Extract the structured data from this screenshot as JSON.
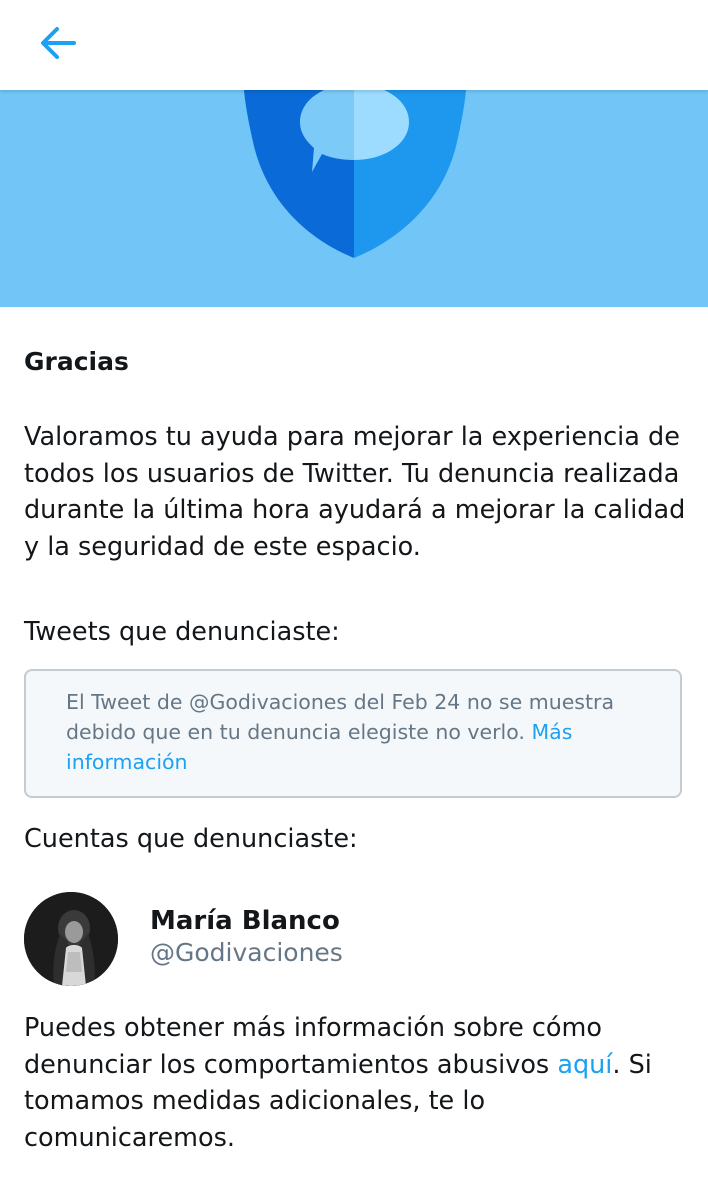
{
  "header": {
    "back_icon": "arrow-left-icon",
    "accent_color": "#1da1f2"
  },
  "banner": {
    "icon": "shield-chat-icon",
    "background_color": "#71c6f7"
  },
  "main": {
    "title": "Gracias",
    "intro": "Valoramos tu ayuda para mejorar la experiencia de todos los usuarios de Twitter. Tu denuncia realizada durante la última hora ayudará a mejorar la calidad y la seguridad de este espacio.",
    "tweets_label": "Tweets que denunciaste:",
    "tweet_notice": {
      "text": "El Tweet de @Godivaciones del Feb 24 no se muestra debido que en tu denuncia elegiste no verlo.",
      "link": "Más información"
    },
    "accounts_label": "Cuentas que denunciaste:",
    "account": {
      "name": "María Blanco",
      "handle": "@Godivaciones"
    },
    "footer": {
      "text_before_link": "Puedes obtener más información sobre cómo denunciar los comportamientos abusivos",
      "link": "aquí",
      "text_after_link": ". Si tomamos medidas adicionales, te lo comunicaremos."
    }
  }
}
